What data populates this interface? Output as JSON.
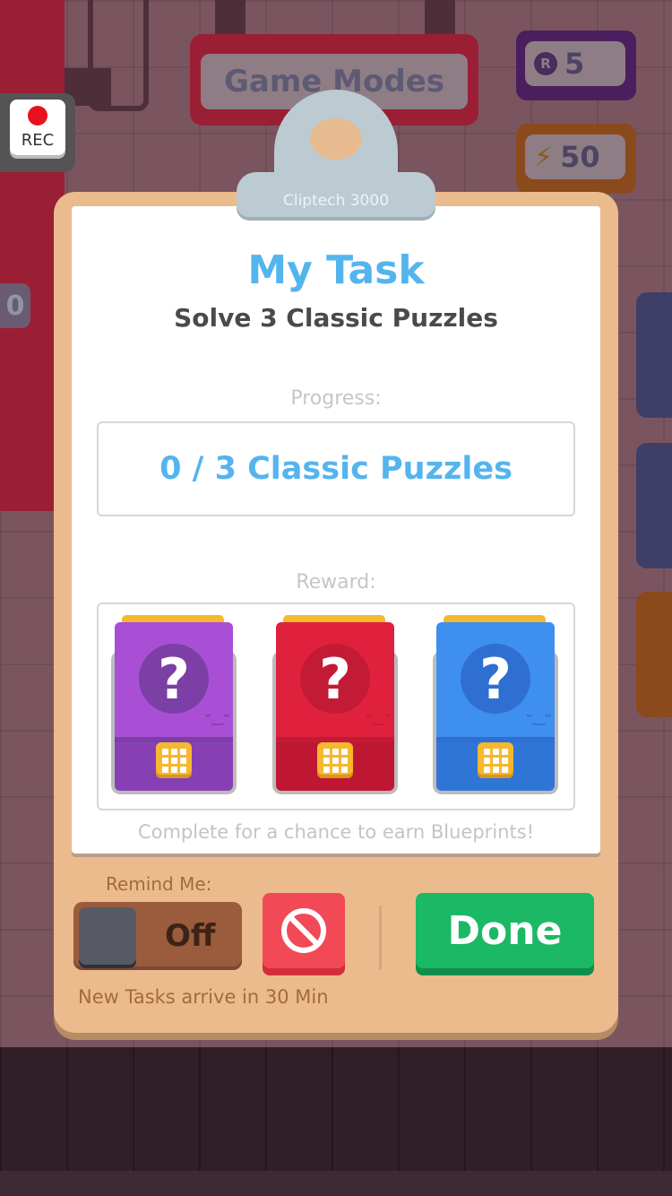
{
  "background": {
    "banner_title": "Game Modes",
    "currency_icon": "R",
    "currency_value": "5",
    "energy_value": "50",
    "left_counter": "0",
    "rec_label": "REC"
  },
  "clipboard": {
    "brand": "Cliptech 3000",
    "title": "My Task",
    "task": "Solve 3 Classic Puzzles",
    "progress_label": "Progress:",
    "progress_text": "0 / 3 Classic Puzzles",
    "progress": {
      "done": 0,
      "total": 3
    },
    "reward_label": "Reward:",
    "rewards": [
      {
        "name": "purple-crate",
        "symbol": "?",
        "face": "ᵕ‿ᵕ",
        "color": "#a94fd6",
        "dark": "#8740b4",
        "circle": "#7b3fa6"
      },
      {
        "name": "red-crate",
        "symbol": "?",
        "face": "ᵕ‿ᵕ",
        "color": "#e0213e",
        "dark": "#bf1632",
        "circle": "#c31a36"
      },
      {
        "name": "blue-crate",
        "symbol": "?",
        "face": "ᵕ‿ᵕ",
        "color": "#3f8ff0",
        "dark": "#2f75d6",
        "circle": "#2e6fd1"
      }
    ],
    "reward_note": "Complete for a chance to earn Blueprints!"
  },
  "controls": {
    "remind_label": "Remind Me:",
    "toggle_state": "Off",
    "done_label": "Done",
    "new_tasks_text": "New Tasks arrive in 30 Min"
  },
  "colors": {
    "accent_blue": "#54b4ee",
    "done_green": "#1bb865",
    "cancel_red": "#f14a56",
    "clipboard": "#ebbb8d"
  }
}
